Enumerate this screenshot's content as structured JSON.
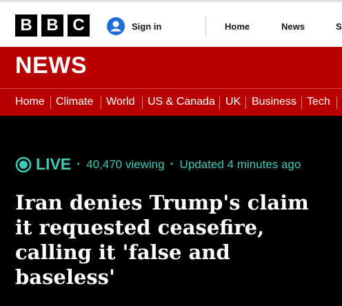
{
  "masthead": {
    "logo_letters": [
      "B",
      "B",
      "C"
    ],
    "signin_label": "Sign in",
    "nav": [
      "Home",
      "News",
      "S"
    ]
  },
  "section_title": "NEWS",
  "section_nav": [
    "Home",
    "Climate",
    "World",
    "US & Canada",
    "UK",
    "Business",
    "Tech"
  ],
  "live": {
    "label": "LIVE",
    "viewing": "40,470 viewing",
    "updated": "Updated 4 minutes ago"
  },
  "headline": "Iran denies Trump's claim it requested ceasefire, calling it 'false and baseless'",
  "colors": {
    "brand_red": "#b80000",
    "live_teal": "#3ecbb8"
  },
  "icons": {
    "signin": "user-avatar-icon",
    "live": "live-pulse-icon"
  }
}
